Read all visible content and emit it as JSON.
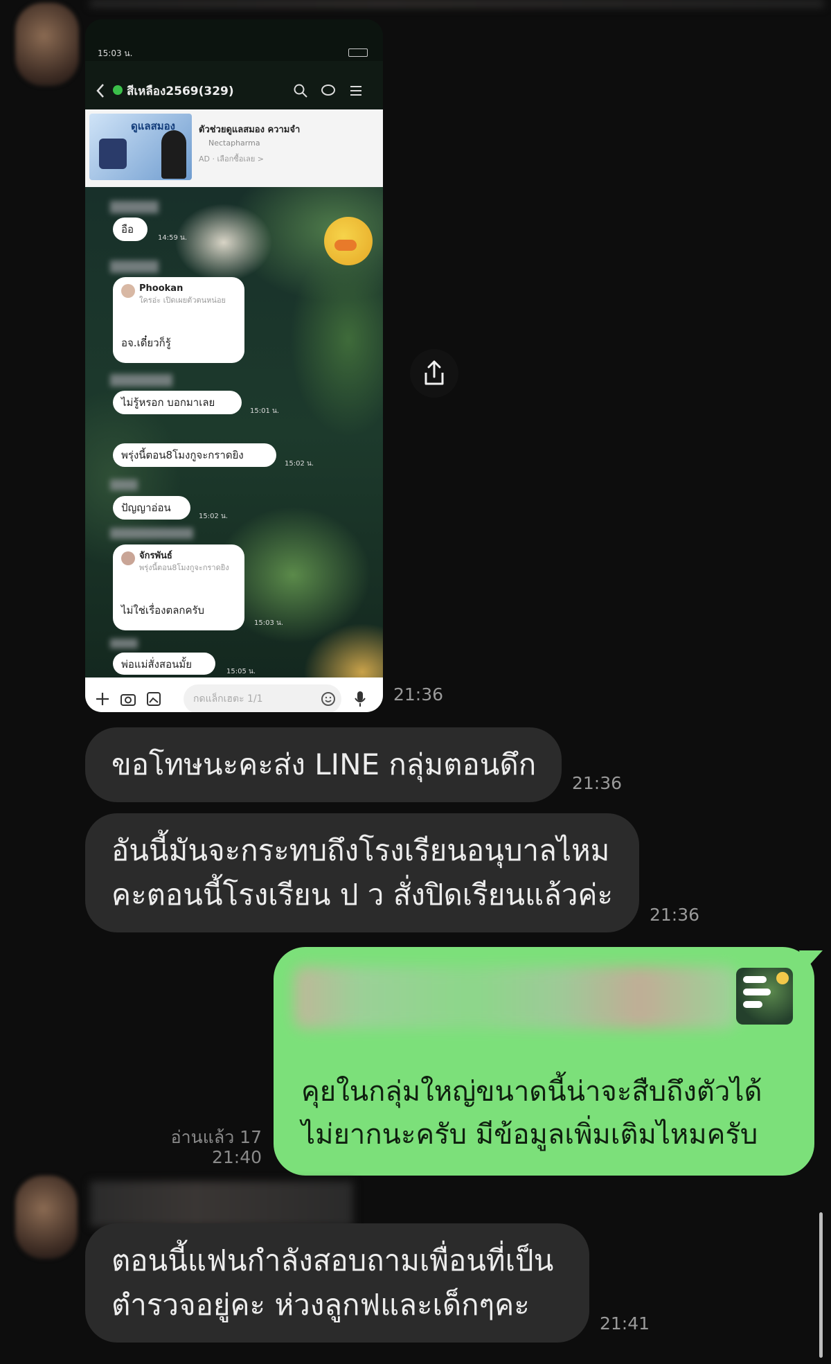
{
  "phone": {
    "status_time": "15:03 น.",
    "chat_title": "สีเหลือง2569(329)",
    "ad": {
      "banner_text": "ดูแลสมอง",
      "title": "ตัวช่วยดูแลสมอง ความจำ",
      "advertiser": "Nectapharma",
      "footer": "AD · เลือกซื้อเลย >"
    },
    "messages": [
      {
        "text": "อือ",
        "time": "14:59 น."
      },
      {
        "reply_name": "Phookan",
        "reply_quote": "ใครอ่ะ เปิดเผยตัวตนหน่อย",
        "text": "อจ.เดี๋ยวก็รู้",
        "time": ""
      },
      {
        "text": "ไม่รู้หรอก บอกมาเลย",
        "time": "15:01 น."
      },
      {
        "text": "พรุ่งนี้ตอน8โมงกูจะกราดยิง",
        "time": "15:02 น."
      },
      {
        "text": "ปัญญาอ่อน",
        "time": "15:02 น."
      },
      {
        "reply_name": "จักรพันธ์",
        "reply_quote": "พรุ่งนี้ตอน8โมงกูจะกราดยิง",
        "text": "ไม่ใช่เรื่องตลกครับ",
        "time": "15:03 น."
      },
      {
        "text": "พ่อแม่สั่งสอนมั้ย",
        "time": "15:05 น."
      }
    ],
    "input_placeholder": "กดแล็กเฮตะ 1/1"
  },
  "phone_time": "21:36",
  "messages": [
    {
      "text": "ขอโทษนะคะส่ง LINE กลุ่มตอนดึก",
      "time": "21:36"
    },
    {
      "line1": "อันนี้มันจะกระทบถึงโรงเรียนอนุบาลไหม",
      "line2": "คะตอนนี้โรงเรียน ป ว สั่งปิดเรียนแล้วค่ะ",
      "time": "21:36"
    }
  ],
  "outgoing": {
    "line1": "คุยในกลุ่มใหญ่ขนาดนี้น่าจะสืบถึงตัวได้",
    "line2": "ไม่ยากนะครับ มีข้อมูลเพิ่มเติมไหมครับ",
    "read_label": "อ่านแล้ว 17",
    "time": "21:40"
  },
  "last_message": {
    "line1": "ตอนนี้แฟนกำลังสอบถามเพื่อนที่เป็น",
    "line2": "ตำรวจอยู่คะ ห่วงลูกฟและเด็กๆคะ",
    "time": "21:41"
  },
  "icons": {
    "share": "share-icon",
    "back": "chevron-left-icon",
    "search": "search-icon",
    "menu": "menu-icon",
    "plus": "plus-icon",
    "camera": "camera-icon",
    "image": "image-icon",
    "emoji": "emoji-icon",
    "mic": "mic-icon"
  },
  "colors": {
    "background": "#0d0d0d",
    "incoming_bubble": "#2b2b2b",
    "outgoing_bubble": "#7ce07a"
  }
}
